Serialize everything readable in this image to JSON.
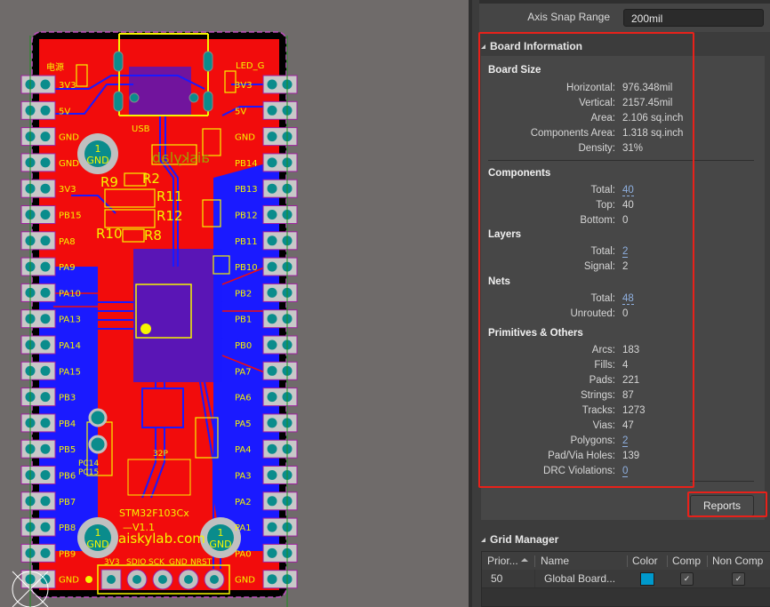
{
  "pcb": {
    "header_labels": {
      "power": "电源",
      "led": "LED_G",
      "usb": "USB",
      "logo_mirrored": "aiskylab",
      "chip": "STM32F103Cx",
      "version": "—V1.1",
      "website": "aiskylab.com",
      "crystal": "32P",
      "pc14": "PC14",
      "pc15": "PC15"
    },
    "mount_holes": [
      {
        "num": "1",
        "net": "GND"
      },
      {
        "num": "1",
        "net": "GND"
      },
      {
        "num": "1",
        "net": "GND"
      }
    ],
    "resistors": [
      "R9",
      "R2",
      "R11",
      "R12",
      "R10",
      "R8"
    ],
    "left_pins": [
      "3V3",
      "5V",
      "GND",
      "GND",
      "3V3",
      "PB15",
      "PA8",
      "PA9",
      "PA10",
      "PA13",
      "PA14",
      "PA15",
      "PB3",
      "PB4",
      "PB5",
      "PB6",
      "PB7",
      "PB8",
      "PB9",
      "GND"
    ],
    "right_pins": [
      "3V3",
      "5V",
      "GND",
      "PB14",
      "PB13",
      "PB12",
      "PB11",
      "PB10",
      "PB2",
      "PB1",
      "PB0",
      "PA7",
      "PA6",
      "PA5",
      "PA4",
      "PA3",
      "PA2",
      "PA1",
      "PA0",
      "GND"
    ],
    "swd_labels": [
      "3V3",
      "SDIO",
      "SCK",
      "GND",
      "NRST"
    ]
  },
  "panel": {
    "axis_snap": {
      "label": "Axis Snap Range",
      "value": "200mil"
    },
    "board_info": {
      "title": "Board Information",
      "board_size": {
        "title": "Board Size",
        "rows": [
          {
            "k": "Horizontal:",
            "v": "976.348mil"
          },
          {
            "k": "Vertical:",
            "v": "2157.45mil"
          },
          {
            "k": "Area:",
            "v": "2.106 sq.inch"
          },
          {
            "k": "Components Area:",
            "v": "1.318 sq.inch"
          },
          {
            "k": "Density:",
            "v": "31%"
          }
        ]
      },
      "components": {
        "title": "Components",
        "rows": [
          {
            "k": "Total:",
            "v": "40"
          },
          {
            "k": "Top:",
            "v": "40"
          },
          {
            "k": "Bottom:",
            "v": "0"
          }
        ]
      },
      "layers": {
        "title": "Layers",
        "rows": [
          {
            "k": "Total:",
            "v": "2"
          },
          {
            "k": "Signal:",
            "v": "2"
          }
        ]
      },
      "nets": {
        "title": "Nets",
        "rows": [
          {
            "k": "Total:",
            "v": "48"
          },
          {
            "k": "Unrouted:",
            "v": "0"
          }
        ]
      },
      "primitives": {
        "title": "Primitives & Others",
        "rows": [
          {
            "k": "Arcs:",
            "v": "183"
          },
          {
            "k": "Fills:",
            "v": "4"
          },
          {
            "k": "Pads:",
            "v": "221"
          },
          {
            "k": "Strings:",
            "v": "87"
          },
          {
            "k": "Tracks:",
            "v": "1273"
          },
          {
            "k": "Vias:",
            "v": "47"
          },
          {
            "k": "Polygons:",
            "v": "2"
          },
          {
            "k": "Pad/Via Holes:",
            "v": "139"
          },
          {
            "k": "DRC Violations:",
            "v": "0"
          }
        ]
      },
      "reports_button": "Reports"
    },
    "grid_manager": {
      "title": "Grid Manager",
      "columns": [
        "Prior...",
        "Name",
        "Color",
        "Comp",
        "Non Comp"
      ],
      "rows": [
        {
          "priority": "50",
          "name": "Global Board...",
          "color": "#0099cc",
          "comp": true,
          "non_comp": true
        }
      ]
    }
  }
}
